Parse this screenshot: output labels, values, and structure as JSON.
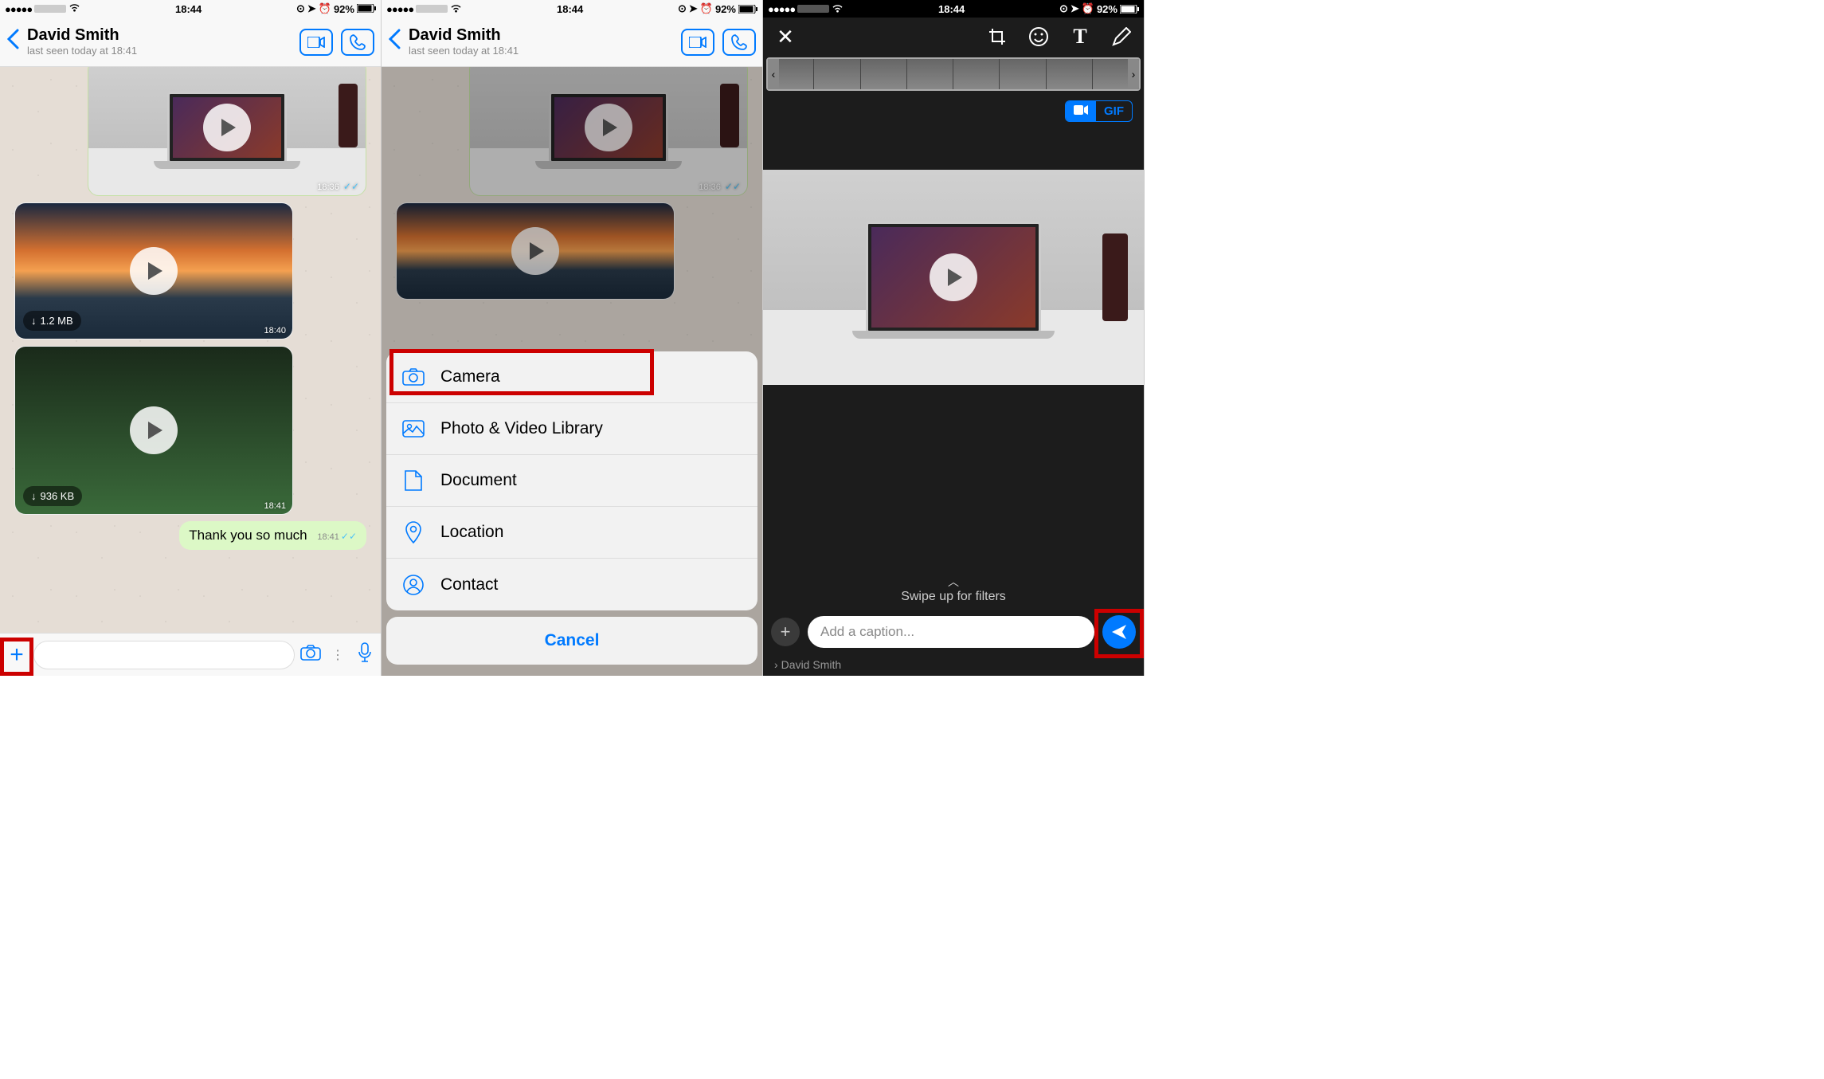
{
  "status": {
    "carrier": "•••••",
    "time": "18:44",
    "battery": "92%"
  },
  "contact": {
    "name": "David Smith",
    "lastSeen": "last seen today at 18:41"
  },
  "messages": {
    "vid1_time": "18:36",
    "vid2_time": "18:40",
    "vid2_size": "1.2 MB",
    "vid3_time": "18:41",
    "vid3_size": "936 KB",
    "text": "Thank you so much",
    "text_time": "18:41"
  },
  "sheet": {
    "camera": "Camera",
    "library": "Photo & Video Library",
    "document": "Document",
    "location": "Location",
    "contact": "Contact",
    "cancel": "Cancel"
  },
  "editor": {
    "gif": "GIF",
    "swipe": "Swipe up for filters",
    "caption": "Add a caption...",
    "recipient": "David Smith"
  }
}
